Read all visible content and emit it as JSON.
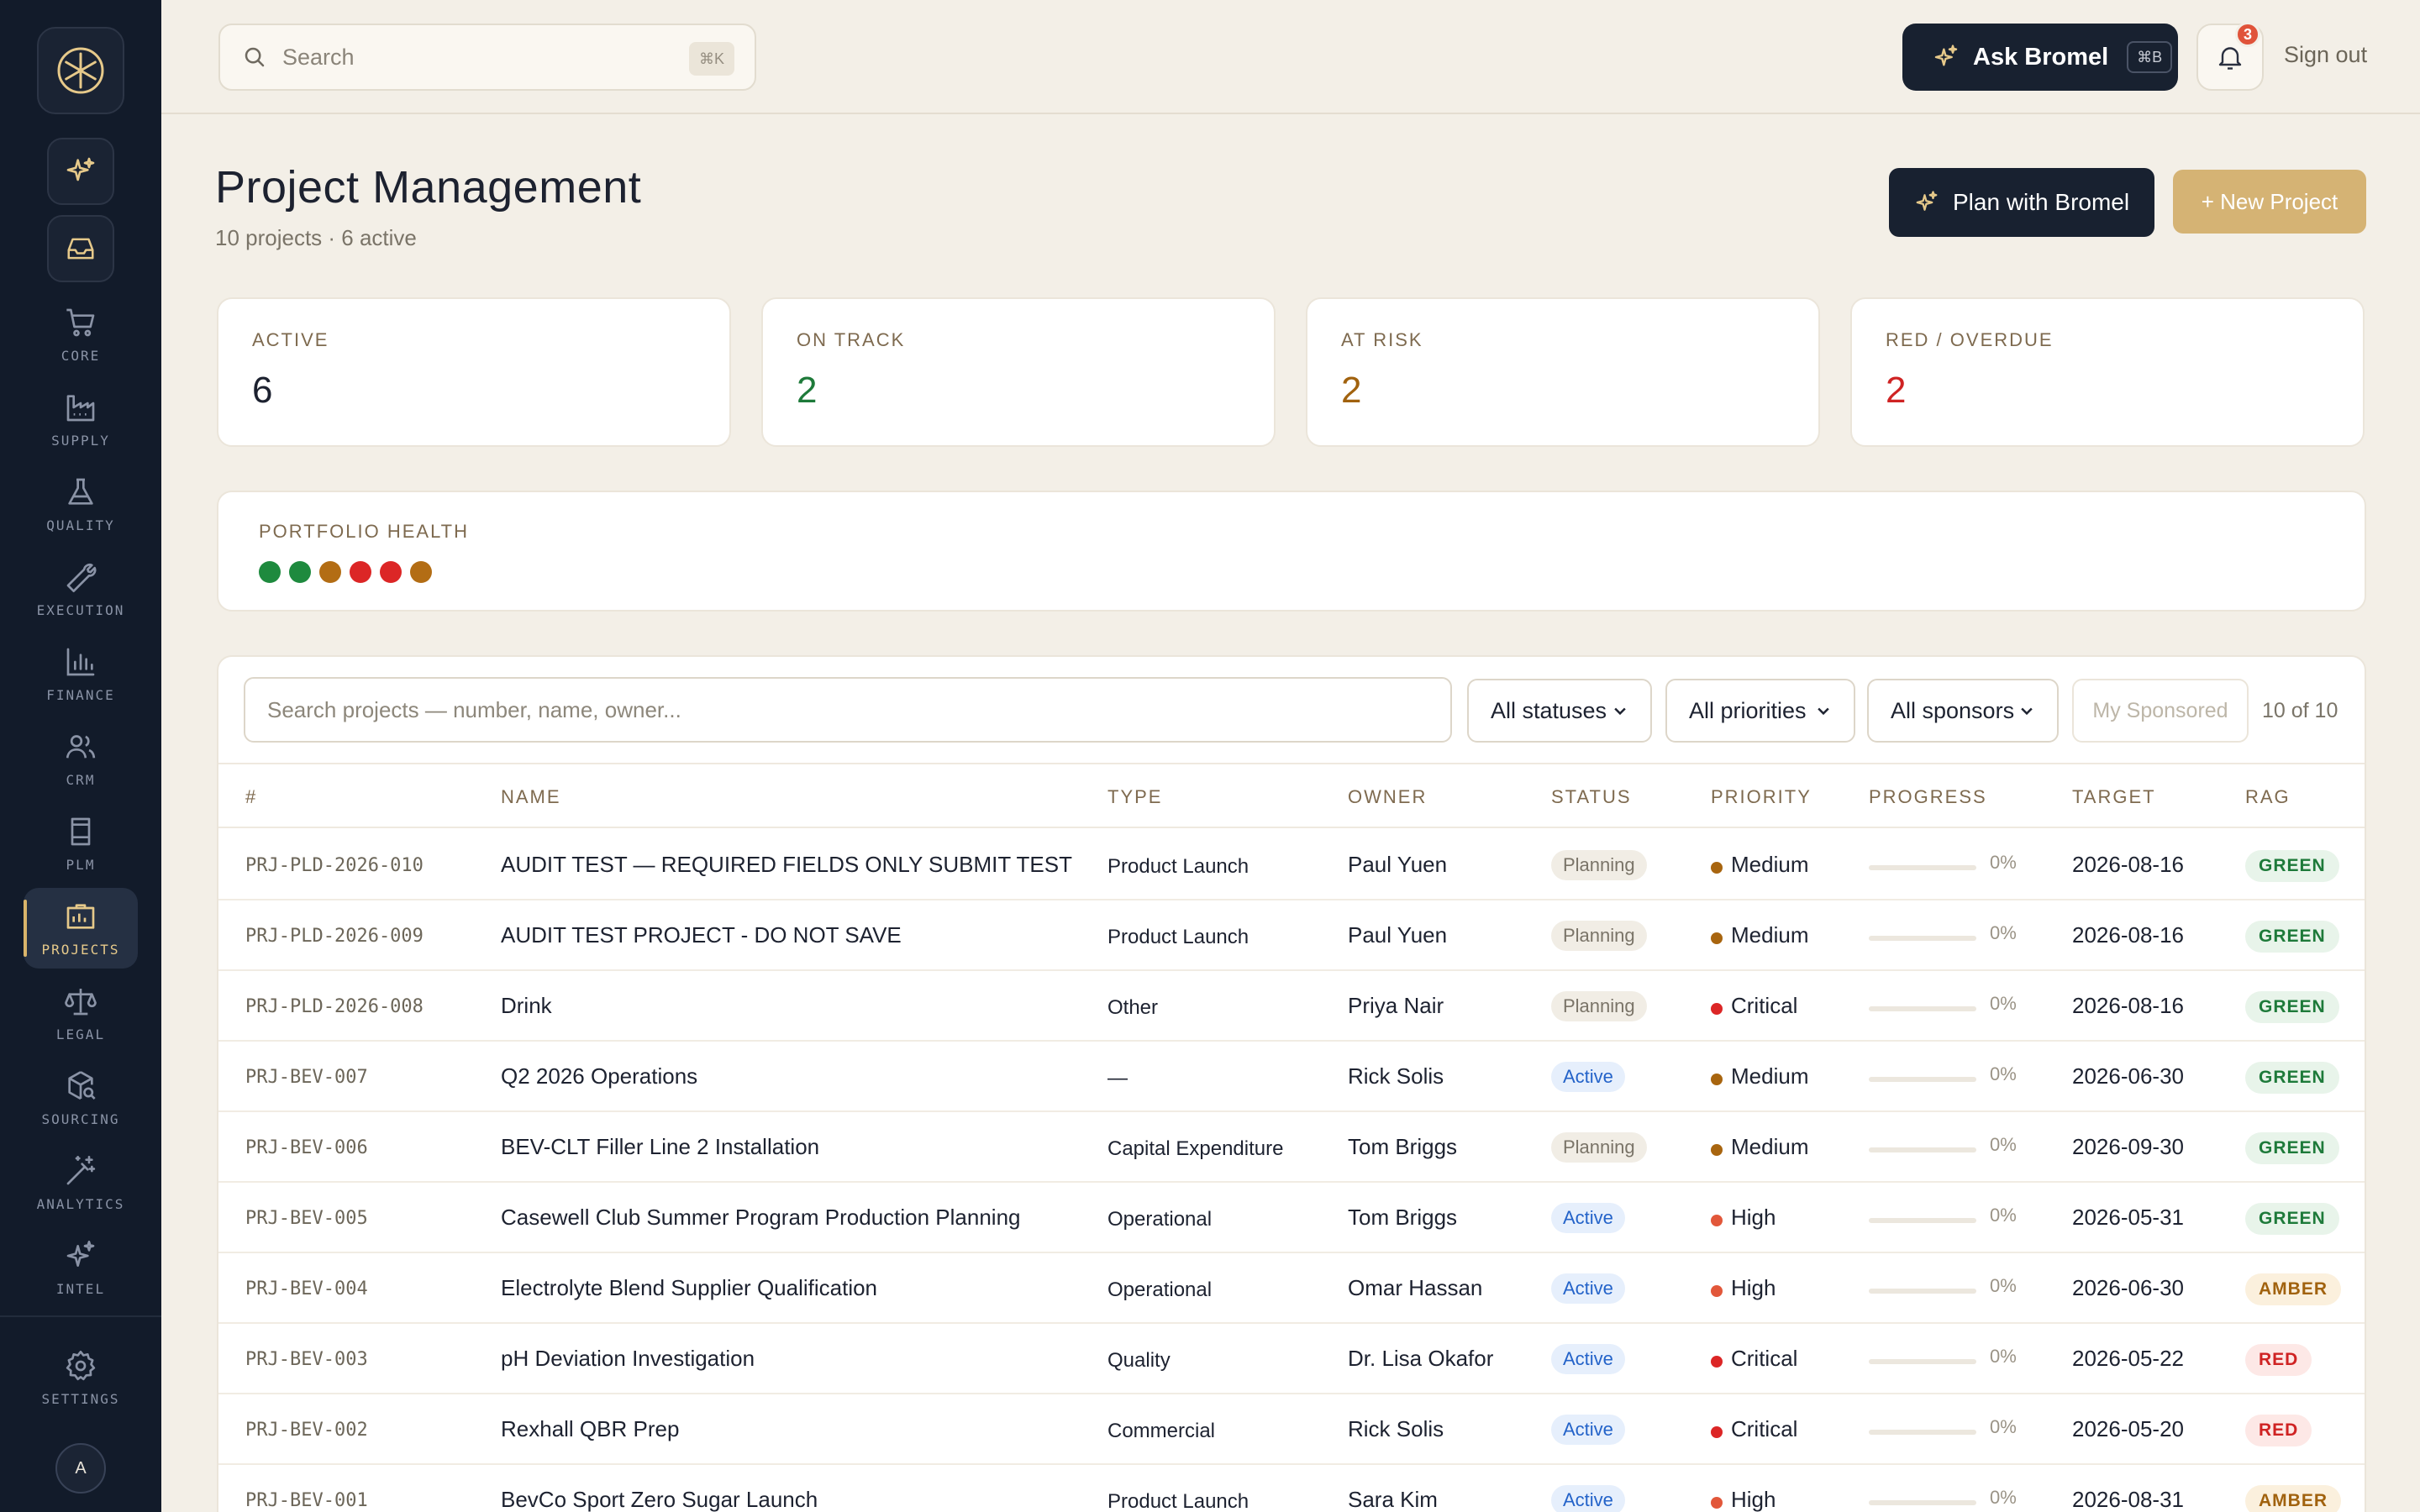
{
  "sidebar": {
    "nav": [
      {
        "label": "CORE",
        "icon": "cart-icon"
      },
      {
        "label": "SUPPLY",
        "icon": "factory-icon"
      },
      {
        "label": "QUALITY",
        "icon": "flask-icon"
      },
      {
        "label": "EXECUTION",
        "icon": "wrench-icon"
      },
      {
        "label": "FINANCE",
        "icon": "bar-chart-icon"
      },
      {
        "label": "CRM",
        "icon": "users-icon"
      },
      {
        "label": "PLM",
        "icon": "cylinder-icon"
      },
      {
        "label": "PROJECTS",
        "icon": "project-board-icon",
        "active": true
      },
      {
        "label": "LEGAL",
        "icon": "scales-icon"
      },
      {
        "label": "SOURCING",
        "icon": "package-search-icon"
      },
      {
        "label": "ANALYTICS",
        "icon": "wand-icon"
      },
      {
        "label": "INTEL",
        "icon": "sparkles-icon"
      }
    ],
    "settings_label": "SETTINGS",
    "avatar_initial": "A"
  },
  "topbar": {
    "search_placeholder": "Search",
    "search_shortcut": "⌘K",
    "ask_label": "Ask Bromel",
    "ask_shortcut": "⌘B",
    "notification_count": "3",
    "signout_label": "Sign out"
  },
  "header": {
    "title": "Project Management",
    "subtitle": "10 projects · 6 active",
    "plan_label": "Plan with Bromel",
    "new_label": "+ New Project"
  },
  "stats": [
    {
      "label": "ACTIVE",
      "value": "6",
      "color": "#1d2230"
    },
    {
      "label": "ON TRACK",
      "value": "2",
      "color": "#1e7a3a"
    },
    {
      "label": "AT RISK",
      "value": "2",
      "color": "#a1620e"
    },
    {
      "label": "RED / OVERDUE",
      "value": "2",
      "color": "#cf2323"
    }
  ],
  "portfolio": {
    "label": "PORTFOLIO HEALTH",
    "dots": [
      "#1e8a3e",
      "#1e8a3e",
      "#b36d14",
      "#dc2626",
      "#dc2626",
      "#b36d14"
    ]
  },
  "filters": {
    "search_placeholder": "Search projects — number, name, owner...",
    "status": "All statuses",
    "priority": "All priorities",
    "sponsor": "All sponsors",
    "my_sponsored": "My Sponsored",
    "count": "10 of 10"
  },
  "table": {
    "headers": [
      "#",
      "NAME",
      "TYPE",
      "OWNER",
      "STATUS",
      "PRIORITY",
      "PROGRESS",
      "TARGET",
      "RAG"
    ],
    "rows": [
      {
        "num": "PRJ-PLD-2026-010",
        "name": "AUDIT TEST — REQUIRED FIELDS ONLY SUBMIT TEST",
        "type": "Product Launch",
        "owner": "Paul Yuen",
        "status": "Planning",
        "priority": "Medium",
        "progress": "0%",
        "target": "2026-08-16",
        "rag": "GREEN"
      },
      {
        "num": "PRJ-PLD-2026-009",
        "name": "AUDIT TEST PROJECT - DO NOT SAVE",
        "type": "Product Launch",
        "owner": "Paul Yuen",
        "status": "Planning",
        "priority": "Medium",
        "progress": "0%",
        "target": "2026-08-16",
        "rag": "GREEN"
      },
      {
        "num": "PRJ-PLD-2026-008",
        "name": "Drink",
        "type": "Other",
        "owner": "Priya Nair",
        "status": "Planning",
        "priority": "Critical",
        "progress": "0%",
        "target": "2026-08-16",
        "rag": "GREEN"
      },
      {
        "num": "PRJ-BEV-007",
        "name": "Q2 2026 Operations",
        "type": "—",
        "owner": "Rick Solis",
        "status": "Active",
        "priority": "Medium",
        "progress": "0%",
        "target": "2026-06-30",
        "rag": "GREEN"
      },
      {
        "num": "PRJ-BEV-006",
        "name": "BEV-CLT Filler Line 2 Installation",
        "type": "Capital Expenditure",
        "owner": "Tom Briggs",
        "status": "Planning",
        "priority": "Medium",
        "progress": "0%",
        "target": "2026-09-30",
        "rag": "GREEN"
      },
      {
        "num": "PRJ-BEV-005",
        "name": "Casewell Club Summer Program Production Planning",
        "type": "Operational",
        "owner": "Tom Briggs",
        "status": "Active",
        "priority": "High",
        "progress": "0%",
        "target": "2026-05-31",
        "rag": "GREEN"
      },
      {
        "num": "PRJ-BEV-004",
        "name": "Electrolyte Blend Supplier Qualification",
        "type": "Operational",
        "owner": "Omar Hassan",
        "status": "Active",
        "priority": "High",
        "progress": "0%",
        "target": "2026-06-30",
        "rag": "AMBER"
      },
      {
        "num": "PRJ-BEV-003",
        "name": "pH Deviation Investigation",
        "type": "Quality",
        "owner": "Dr. Lisa Okafor",
        "status": "Active",
        "priority": "Critical",
        "progress": "0%",
        "target": "2026-05-22",
        "rag": "RED"
      },
      {
        "num": "PRJ-BEV-002",
        "name": "Rexhall QBR Prep",
        "type": "Commercial",
        "owner": "Rick Solis",
        "status": "Active",
        "priority": "Critical",
        "progress": "0%",
        "target": "2026-05-20",
        "rag": "RED"
      },
      {
        "num": "PRJ-BEV-001",
        "name": "BevCo Sport Zero Sugar Launch",
        "type": "Product Launch",
        "owner": "Sara Kim",
        "status": "Active",
        "priority": "High",
        "progress": "0%",
        "target": "2026-08-31",
        "rag": "AMBER"
      }
    ]
  },
  "colors": {
    "priority": {
      "Medium": "#a8650f",
      "High": "#e2573a",
      "Critical": "#dc2626"
    },
    "rag": {
      "GREEN": {
        "bg": "#e8f4ea",
        "fg": "#1e7a3a"
      },
      "AMBER": {
        "bg": "#fbf0dd",
        "fg": "#a1620e"
      },
      "RED": {
        "bg": "#fde8e6",
        "fg": "#cf2323"
      }
    },
    "status": {
      "Planning": {
        "bg": "#f1ede5",
        "fg": "#7a7468"
      },
      "Active": {
        "bg": "#e6effc",
        "fg": "#2463c9"
      }
    }
  }
}
